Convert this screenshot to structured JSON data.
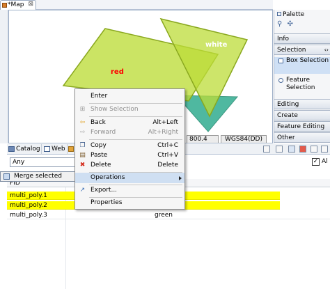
{
  "editor": {
    "tab_title": "*Map",
    "tab_close": "⊠",
    "labels": {
      "red": "red",
      "white": "white"
    },
    "status": {
      "scale": "800.4",
      "crs": "WGS84(DD)"
    }
  },
  "palette": {
    "title": "Palette",
    "categories": [
      "Info",
      "Selection",
      "Editing",
      "Create",
      "Feature Editing",
      "Other"
    ],
    "items": [
      "Box Selection",
      "Feature Selection"
    ],
    "scroll_glyph": "‹›"
  },
  "lower": {
    "tabs": [
      "Catalog",
      "Web"
    ],
    "filter_value": "Any",
    "all_label": "Al",
    "merge_label": "Merge selected",
    "table": {
      "header": "FID",
      "rows": [
        {
          "fid": "multi_poly.1",
          "value": ""
        },
        {
          "fid": "multi_poly.2",
          "value": ""
        },
        {
          "fid": "multi_poly.3",
          "value": "green"
        }
      ]
    }
  },
  "menu": {
    "enter": "Enter",
    "show_selection": "Show Selection",
    "back": "Back",
    "back_key": "Alt+Left",
    "forward": "Forward",
    "forward_key": "Alt+Right",
    "copy": "Copy",
    "copy_key": "Ctrl+C",
    "paste": "Paste",
    "paste_key": "Ctrl+V",
    "delete": "Delete",
    "delete_key": "Delete",
    "operations": "Operations",
    "export": "Export...",
    "properties": "Properties"
  },
  "colors": {
    "polygon_fill": "#bcdc38",
    "polygon_stroke": "#8aa81f",
    "teal_fill": "#4fb8a0",
    "highlight": "#ffff00"
  }
}
